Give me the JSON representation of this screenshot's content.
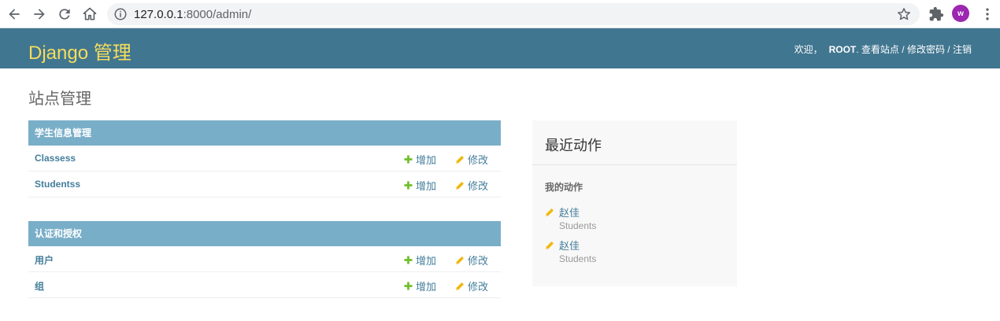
{
  "browser": {
    "url_host": "127.0.0.1",
    "url_rest": ":8000/admin/",
    "avatar_letter": "w"
  },
  "header": {
    "brand": "Django 管理",
    "welcome": "欢迎，",
    "username": "ROOT",
    "sep1": ". ",
    "view_site": "查看站点",
    "sep2": " / ",
    "change_password": "修改密码",
    "sep3": " / ",
    "logout": "注销"
  },
  "page_title": "站点管理",
  "modules": [
    {
      "caption": "学生信息管理",
      "rows": [
        {
          "name": "Classess",
          "add": "增加",
          "change": "修改"
        },
        {
          "name": "Studentss",
          "add": "增加",
          "change": "修改"
        }
      ]
    },
    {
      "caption": "认证和授权",
      "rows": [
        {
          "name": "用户",
          "add": "增加",
          "change": "修改"
        },
        {
          "name": "组",
          "add": "增加",
          "change": "修改"
        }
      ]
    }
  ],
  "recent": {
    "title": "最近动作",
    "subtitle": "我的动作",
    "actions": [
      {
        "title": "赵佳",
        "model": "Students"
      },
      {
        "title": "赵佳",
        "model": "Students"
      }
    ]
  },
  "colors": {
    "header_bg": "#417690",
    "brand": "#f5dd5d",
    "caption_bg": "#79aec8",
    "link": "#447e9b",
    "add_icon": "#70bf2b",
    "change_icon": "#efb80b"
  }
}
